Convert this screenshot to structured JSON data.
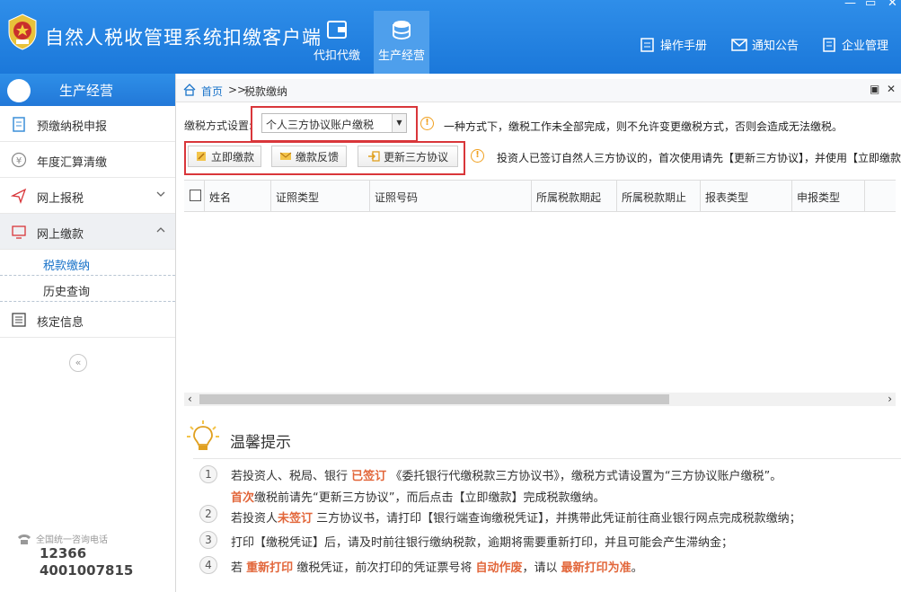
{
  "app": {
    "title": "自然人税收管理系统扣缴客户端"
  },
  "topnav": [
    {
      "label": "代扣代缴"
    },
    {
      "label": "生产经营"
    }
  ],
  "topright": [
    {
      "label": "操作手册"
    },
    {
      "label": "通知公告"
    },
    {
      "label": "企业管理"
    }
  ],
  "sidebar": {
    "title": "生产经营",
    "items": [
      {
        "label": "预缴纳税申报"
      },
      {
        "label": "年度汇算清缴"
      },
      {
        "label": "网上报税"
      },
      {
        "label": "网上缴款"
      },
      {
        "label": "核定信息"
      }
    ],
    "subitems": [
      {
        "label": "税款缴纳"
      },
      {
        "label": "历史查询"
      }
    ],
    "collapse": "«",
    "hotline": {
      "caption": "全国统一咨询电话",
      "num1": "12366",
      "num2": "4001007815"
    }
  },
  "breadcrumb": {
    "home": "首页",
    "sep": ">>",
    "current": "税款缴纳"
  },
  "method": {
    "label": "缴税方式设置:",
    "selected": "个人三方协议账户缴税",
    "note": "一种方式下，缴税工作未全部完成，则不允许变更缴税方式，否则会造成无法缴税。"
  },
  "buttons": {
    "pay": "立即缴款",
    "feedback": "缴款反馈",
    "update": "更新三方协议"
  },
  "notice2": "投资人已签订自然人三方协议的，首次使用请先【更新三方协议】，并使用【立即缴款",
  "table": {
    "columns": [
      "姓名",
      "证照类型",
      "证照号码",
      "所属税款期起",
      "所属税款期止",
      "报表类型",
      "申报类型"
    ]
  },
  "tips": {
    "title": "温馨提示",
    "items": [
      {
        "num": "1",
        "a": "若投资人、税局、银行",
        "b": "已签订",
        "c": "《委托银行代缴税款三方协议书》，缴税方式请设置为“三方协议账户缴税”。"
      },
      {
        "a2": "首次",
        "b2": "缴税前请先“更新三方协议”，而后点击【立即缴款】完成税款缴纳。"
      },
      {
        "num": "2",
        "a": "若投资人",
        "b": "未签订",
        "c": "三方协议书，请打印【银行端查询缴税凭证】，并携带此凭证前往商业银行网点完成税款缴纳；"
      },
      {
        "num": "3",
        "a": "打印【缴税凭证】后，请及时前往银行缴纳税款，逾期将需要重新打印，并且可能会产生滞纳金；"
      },
      {
        "num": "4",
        "a": "若",
        "b": "重新打印",
        "c": "缴税凭证，前次打印的凭证票号将",
        "d": "自动作废",
        "e": "，请以",
        "f": "最新打印为准",
        "g": "。"
      }
    ]
  }
}
